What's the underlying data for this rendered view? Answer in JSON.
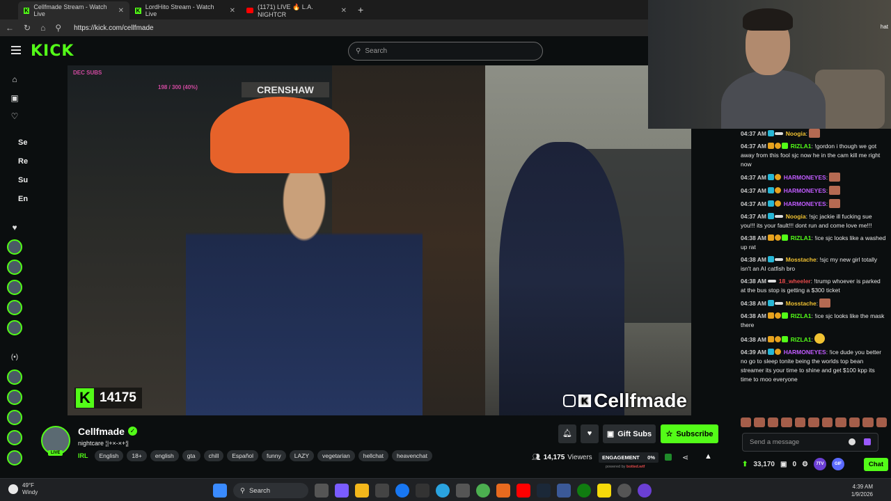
{
  "browser": {
    "tabs": [
      {
        "title": "Cellfmade Stream - Watch Live",
        "favicon": "kick-icon"
      },
      {
        "title": "LordHito Stream - Watch Live",
        "favicon": "kick-icon"
      },
      {
        "title": "(1171) LIVE 🔥 L.A. NIGHTCR",
        "favicon": "youtube-icon"
      }
    ],
    "new_tab": "+",
    "url": "https://kick.com/cellfmade"
  },
  "header": {
    "logo": "KICK",
    "search_placeholder": "Search"
  },
  "sidebar": {
    "labels": [
      "Se",
      "Re",
      "Su",
      "En"
    ]
  },
  "video": {
    "street_sign": "CRENSHAW",
    "overlay_top_left": "DEC SUBS",
    "overlay_goal": "198 / 300 (40%)",
    "viewer_badge": "14175",
    "watermark": "Cellfmade"
  },
  "webcam": {
    "corner_text": "hat"
  },
  "chat": {
    "messages": [
      {
        "time": "04:37 AM",
        "user": "Noogia",
        "color": "#f1c232",
        "text": "",
        "badges": [
          "cyan",
          "sword"
        ],
        "emote": true
      },
      {
        "time": "04:37 AM",
        "user": "RIZLA1",
        "color": "#53fc18",
        "text": "!gordon i though we got away from this fool sjc now he in the cam kill me right now",
        "badges": [
          "gold",
          "sub",
          "green"
        ]
      },
      {
        "time": "04:37 AM",
        "user": "HARMONEYES",
        "color": "#c15cff",
        "text": "",
        "badges": [
          "cyan",
          "sub"
        ],
        "emote": true
      },
      {
        "time": "04:37 AM",
        "user": "HARMONEYES",
        "color": "#c15cff",
        "text": "",
        "badges": [
          "cyan",
          "sub"
        ],
        "emote": true
      },
      {
        "time": "04:37 AM",
        "user": "HARMONEYES",
        "color": "#c15cff",
        "text": "",
        "badges": [
          "cyan",
          "sub"
        ],
        "emote": true
      },
      {
        "time": "04:37 AM",
        "user": "Noogia",
        "color": "#f1c232",
        "text": "!sjc jackie ill fucking sue you!!! its your fault!!! dont run and come love me!!!",
        "badges": [
          "cyan",
          "sword"
        ]
      },
      {
        "time": "04:38 AM",
        "user": "RIZLA1",
        "color": "#53fc18",
        "text": "!ice sjc looks like a washed up rat",
        "badges": [
          "gold",
          "sub",
          "green"
        ]
      },
      {
        "time": "04:38 AM",
        "user": "Mosstache",
        "color": "#f1c232",
        "text": "!sjc my new girl totally isn't an AI catfish bro",
        "badges": [
          "cyan",
          "sword"
        ]
      },
      {
        "time": "04:38 AM",
        "user": "18_wheeler",
        "color": "#e84a4a",
        "text": "!trump whoever is parked at the bus stop is getting a $300 ticket",
        "badges": [
          "sword"
        ]
      },
      {
        "time": "04:38 AM",
        "user": "Mosstache",
        "color": "#f1c232",
        "text": "",
        "badges": [
          "cyan",
          "sword"
        ],
        "emote": true
      },
      {
        "time": "04:38 AM",
        "user": "RIZLA1",
        "color": "#53fc18",
        "text": "!ice sjc looks like the mask there",
        "badges": [
          "gold",
          "sub",
          "green"
        ]
      },
      {
        "time": "04:38 AM",
        "user": "RIZLA1",
        "color": "#53fc18",
        "text": "",
        "badges": [
          "gold",
          "sub",
          "green"
        ],
        "emote_y": true
      },
      {
        "time": "04:39 AM",
        "user": "HARMONEYES",
        "color": "#c15cff",
        "text": "!ice dude you better no go to sleep tonite being the worlds top bean streamer its your time to shine and get $100 kpp its time to moo everyone",
        "badges": [
          "cyan",
          "sub"
        ]
      }
    ],
    "input_placeholder": "Send a message",
    "points": "33,170",
    "gift_count": "0",
    "badge_7tv": "7TV",
    "badge_gif": "GIF",
    "chat_button": "Chat"
  },
  "streamer": {
    "name": "Cellfmade",
    "live": "LIVE",
    "title": "nightcare ¦|+×-×+¦|",
    "category": "IRL",
    "tags": [
      "English",
      "18+",
      "english",
      "gta",
      "chill",
      "Español",
      "funny",
      "LAZY",
      "vegetarian",
      "hellchat",
      "heavenchat"
    ],
    "gift_subs": "Gift Subs",
    "subscribe": "Subscribe",
    "viewers_count": "14,175",
    "viewers_label": "Viewers",
    "engagement_label": "ENGAGEMENT",
    "engagement_value": "0%",
    "powered_prefix": "powered by",
    "powered_brand": "botted.wtf"
  },
  "taskbar": {
    "temp": "49°F",
    "weather": "Windy",
    "search": "Search",
    "time": "4:39 AM",
    "date": "1/9/2026"
  },
  "colors": {
    "kick_green": "#53fc18",
    "background": "#0b0e0f"
  }
}
